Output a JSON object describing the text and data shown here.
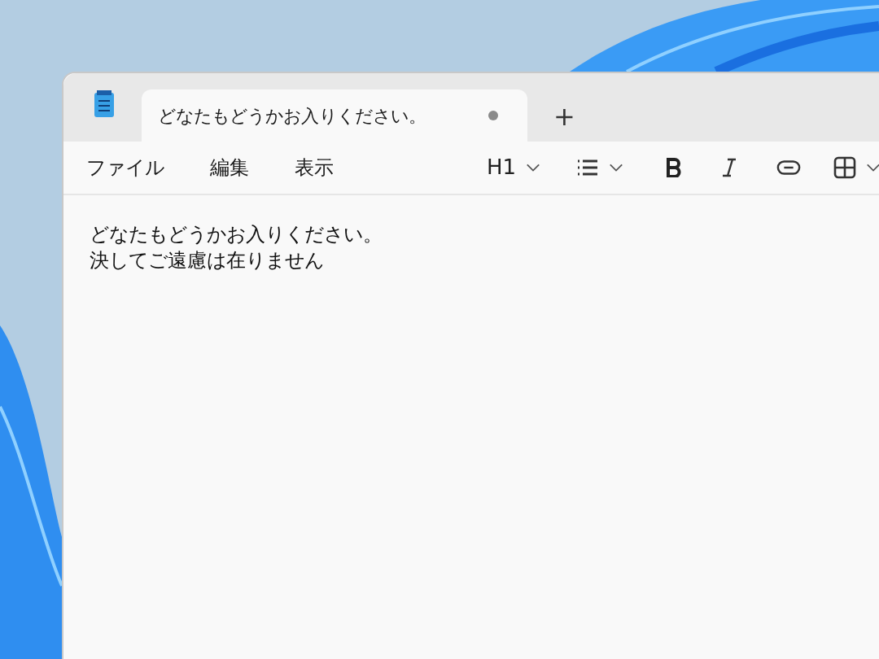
{
  "tabs": [
    {
      "title": "どなたもどうかお入りください。",
      "selected": true,
      "unsaved": true,
      "new_tab_label": "+"
    }
  ],
  "menu": [
    "ファイル",
    "編集",
    "表示"
  ],
  "toolbar": {
    "heading": "H1"
  },
  "document": {
    "lines": [
      "どなたもどうかお入りください。",
      "決してご遠慮は在りません"
    ]
  }
}
